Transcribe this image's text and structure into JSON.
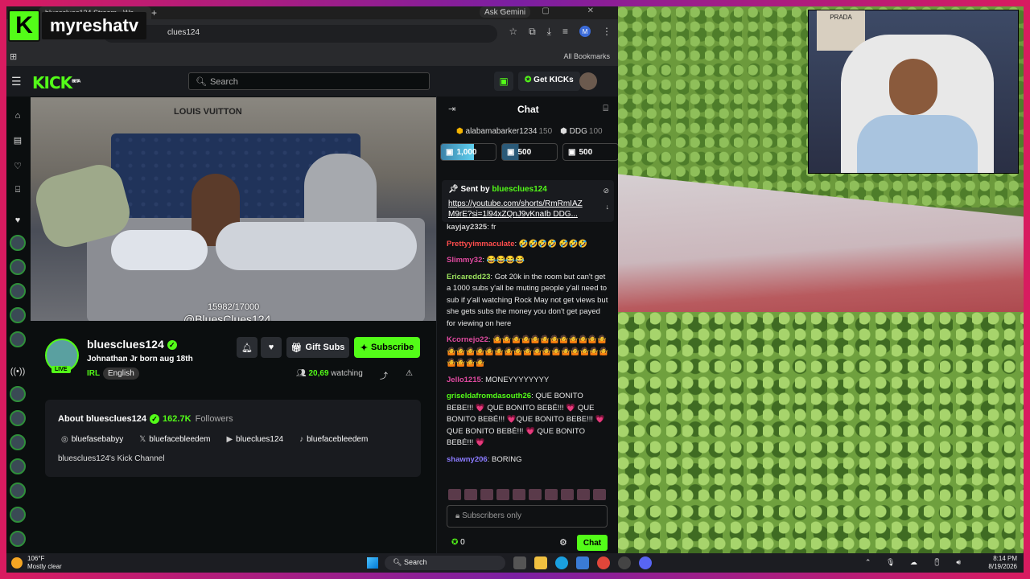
{
  "overlay": {
    "logo_letter": "K",
    "brand": "myreshatv"
  },
  "browser": {
    "tab_title": "bluesclues124 Stream - Wa",
    "new_tab": "+",
    "gemini": "Ask Gemini",
    "window_controls": "– ▢ ✕",
    "url": "clues124",
    "profile_initial": "M",
    "all_bookmarks": "All Bookmarks"
  },
  "kick": {
    "logo": "KICK",
    "beta": "BETA",
    "search_placeholder": "Search",
    "get_kicks": "Get KICKs"
  },
  "video": {
    "counter": "15982/17000",
    "handle": "@BluesClues124",
    "headboard_text": "LOUIS VUITTON"
  },
  "channel": {
    "name": "bluesclues124",
    "title": "Johnathan Jr born aug 18th",
    "category": "IRL",
    "language": "English",
    "live": "LIVE",
    "gift_label": "Gift Subs",
    "subscribe_label": "Subscribe",
    "viewers": "20,69",
    "watching_label": "watching",
    "about_title": "About bluesclues124",
    "followers_count": "162.7K",
    "followers_label": "Followers",
    "socials": [
      {
        "icon": "instagram-icon",
        "glyph": "◎",
        "handle": "bluefasebabyy"
      },
      {
        "icon": "x-icon",
        "glyph": "𝕏",
        "handle": "bluefacebleedem"
      },
      {
        "icon": "youtube-icon",
        "glyph": "▶",
        "handle": "blueclues124"
      },
      {
        "icon": "tiktok-icon",
        "glyph": "♪",
        "handle": "bluefacebleedem"
      }
    ],
    "description": "bluesclues124's Kick Channel"
  },
  "chat": {
    "title": "Chat",
    "leaders": [
      {
        "name": "alabamabarker1234",
        "value": "150"
      },
      {
        "name": "DDG",
        "value": "100"
      }
    ],
    "gifts": [
      "1,000",
      "500",
      "500"
    ],
    "pinned": {
      "sent_by": "Sent by",
      "user": "bluesclues124",
      "link_line1": "https://youtube.com/shorts/RmRmIAZ",
      "link_line2": "M9rE?si=1l94xZQnJ9vKnaIb DDG..."
    },
    "messages": [
      {
        "user": "kayjay2325",
        "color": "#cccccc",
        "text": "fr"
      },
      {
        "user": "Prettyyimmaculate",
        "color": "#ff4d4d",
        "text": "🤣🤣🤣🤣 🤣🤣🤣"
      },
      {
        "user": "Slimmy32",
        "color": "#e04aa0",
        "text": "😂😂😂😂"
      },
      {
        "user": "Ericaredd23",
        "color": "#9be15d",
        "text": "Got 20k in the room but can't get a 1000 subs y'all be muting people y'all need to sub if y'all watching Rock May not get views but she gets subs the money you don't get payed for viewing on here"
      },
      {
        "user": "Kcornejo22",
        "color": "#e04aa0",
        "text": "🤷🤷🤷🤷🤷🤷🤷🤷🤷🤷🤷🤷🤷🤷🤷🤷🤷🤷🤷🤷🤷🤷🤷🤷🤷🤷🤷🤷🤷🤷🤷🤷🤷"
      },
      {
        "user": "Jello1215",
        "color": "#e04aa0",
        "text": "MONEYYYYYYYY"
      },
      {
        "user": "griseldafromdasouth26",
        "color": "#53fc18",
        "text": "QUE BONITO BEBE!!! 💗 QUE BONITO BEBÉ!!! 💗 QUE BONITO BEBÉ!!! 💗QUE BONITO BEBE!!! 💗 QUE BONITO BEBÉ!!! 💗 QUE BONITO BEBÉ!!! 💗"
      },
      {
        "user": "shawny206",
        "color": "#8b7bff",
        "text": "BORING"
      }
    ],
    "input_placeholder": "Subscribers only",
    "kicks_count": "0",
    "send_label": "Chat"
  },
  "cam": {
    "sign_text": "PRADA"
  },
  "taskbar": {
    "temp": "106°F",
    "weather": "Mostly clear",
    "search": "Search",
    "time": "8:14 PM",
    "date": "8/19/2026"
  }
}
